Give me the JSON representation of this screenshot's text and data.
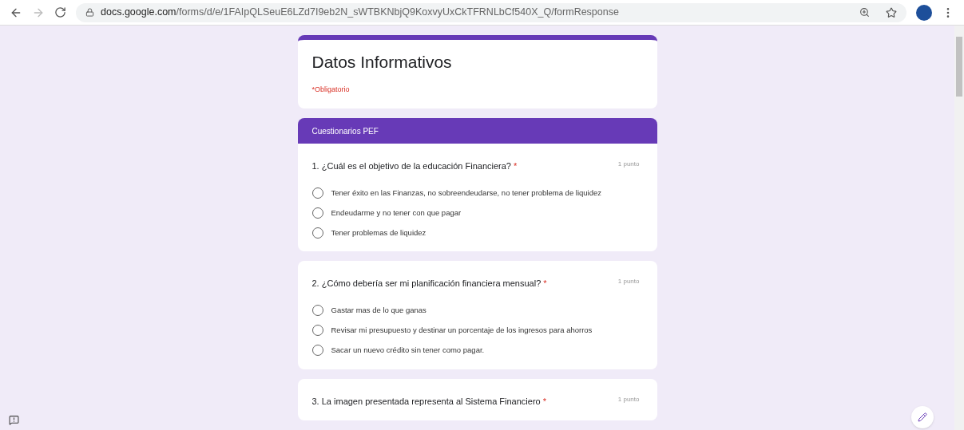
{
  "browser": {
    "url_host": "docs.google.com",
    "url_path": "/forms/d/e/1FAIpQLSeuE6LZd7I9eb2N_sWTBKNbjQ9KoxvyUxCkTFRNLbCf540X_Q/formResponse"
  },
  "form": {
    "title": "Datos Informativos",
    "required_note": "*Obligatorio"
  },
  "section": {
    "title": "Cuestionarios PEF"
  },
  "questions": [
    {
      "title": "1. ¿Cuál es el objetivo de la educación Financiera?",
      "required_mark": "*",
      "points": "1 punto",
      "options": [
        {
          "label": "Tener éxito en las Finanzas, no sobreendeudarse, no tener problema de liquidez",
          "selected": false
        },
        {
          "label": "Endeudarme y no tener con que pagar",
          "selected": false
        },
        {
          "label": "Tener problemas de liquidez",
          "selected": false
        }
      ]
    },
    {
      "title": "2. ¿Cómo debería ser mi planificación financiera mensual?",
      "required_mark": "*",
      "points": "1 punto",
      "options": [
        {
          "label": "Gastar mas de lo que ganas",
          "selected": false
        },
        {
          "label": "Revisar mi presupuesto y destinar un porcentaje de los ingresos para ahorros",
          "selected": false
        },
        {
          "label": "Sacar un nuevo crédito sin tener como pagar.",
          "selected": false
        }
      ]
    },
    {
      "title": "3. La imagen presentada representa al Sistema Financiero",
      "required_mark": "*",
      "points": "1 punto"
    }
  ]
}
